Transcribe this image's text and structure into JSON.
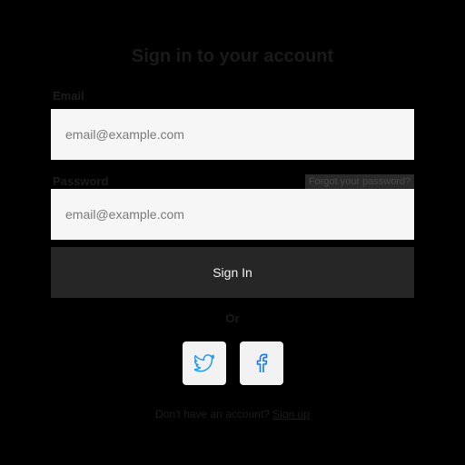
{
  "header": {
    "title": "Sign in to your account"
  },
  "form": {
    "email_label": "Email",
    "email_placeholder": "email@example.com",
    "password_label": "Password",
    "forgot_label": "Forgot your password?",
    "password_placeholder": "email@example.com",
    "submit_label": "Sign In"
  },
  "divider": {
    "text": "Or"
  },
  "social": [
    {
      "icon": "twitter-icon",
      "color": "#1d9bf0"
    },
    {
      "icon": "facebook-icon",
      "color": "#1877f2"
    }
  ],
  "footer": {
    "prompt": "Don't have an account?",
    "link": "Sign up"
  },
  "colors": {
    "background": "#000000",
    "field_background": "#f6f6f6",
    "button_background": "#262626",
    "button_text": "#f2f2f2"
  }
}
